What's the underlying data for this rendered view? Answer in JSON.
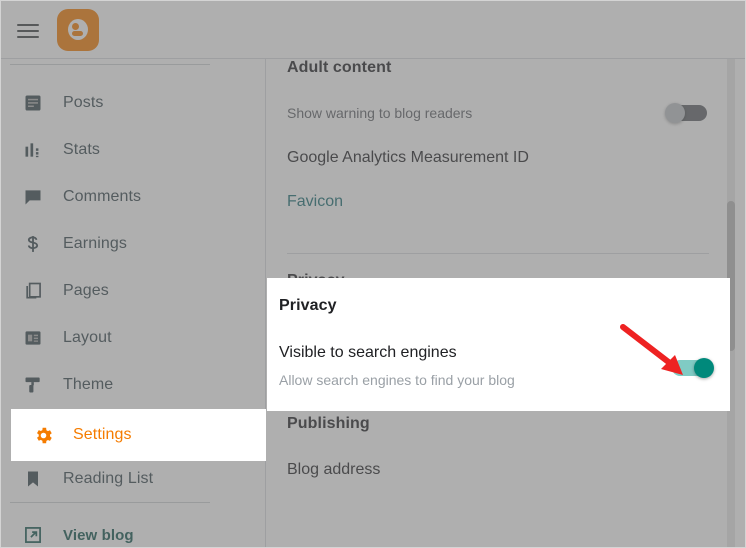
{
  "app": {
    "name": "Blogger",
    "logo_letter": "B",
    "brand_color": "#f57c00"
  },
  "topbar": {
    "menu_icon": "hamburger-menu-icon",
    "logo_icon": "blogger-logo-icon"
  },
  "sidebar": {
    "items": [
      {
        "label": "Posts",
        "icon": "posts-icon",
        "active": false
      },
      {
        "label": "Stats",
        "icon": "stats-bar-chart-icon",
        "active": false
      },
      {
        "label": "Comments",
        "icon": "comments-speech-bubble-icon",
        "active": false
      },
      {
        "label": "Earnings",
        "icon": "earnings-dollar-icon",
        "active": false
      },
      {
        "label": "Pages",
        "icon": "pages-copy-icon",
        "active": false
      },
      {
        "label": "Layout",
        "icon": "layout-icon",
        "active": false
      },
      {
        "label": "Theme",
        "icon": "theme-paint-roller-icon",
        "active": false
      },
      {
        "label": "Settings",
        "icon": "settings-gear-icon",
        "active": true
      },
      {
        "label": "Reading List",
        "icon": "reading-list-bookmark-icon",
        "active": false
      }
    ],
    "view_blog": {
      "label": "View blog",
      "icon": "external-link-icon",
      "color": "#10554f"
    },
    "active_item_color": "#f57c00",
    "item_color": "#37474f"
  },
  "content": {
    "adult_content": {
      "heading": "Adult content",
      "warning_row_label": "Show warning to blog readers",
      "warning_toggle_state": "off"
    },
    "google_analytics": {
      "heading": "Google Analytics Measurement ID"
    },
    "favicon": {
      "label": "Favicon",
      "color": "#1a6e73"
    },
    "privacy": {
      "heading": "Privacy",
      "setting_title": "Visible to search engines",
      "setting_description": "Allow search engines to find your blog",
      "toggle_state": "on",
      "toggle_on_color": "#00897b",
      "toggle_track_color": "#80cbc4"
    },
    "publishing": {
      "heading": "Publishing",
      "blog_address_label": "Blog address"
    }
  },
  "annotation": {
    "arrow_icon": "red-pointer-arrow-icon",
    "color": "#ee2222",
    "points_at": "privacy-visible-to-search-engines-toggle"
  }
}
